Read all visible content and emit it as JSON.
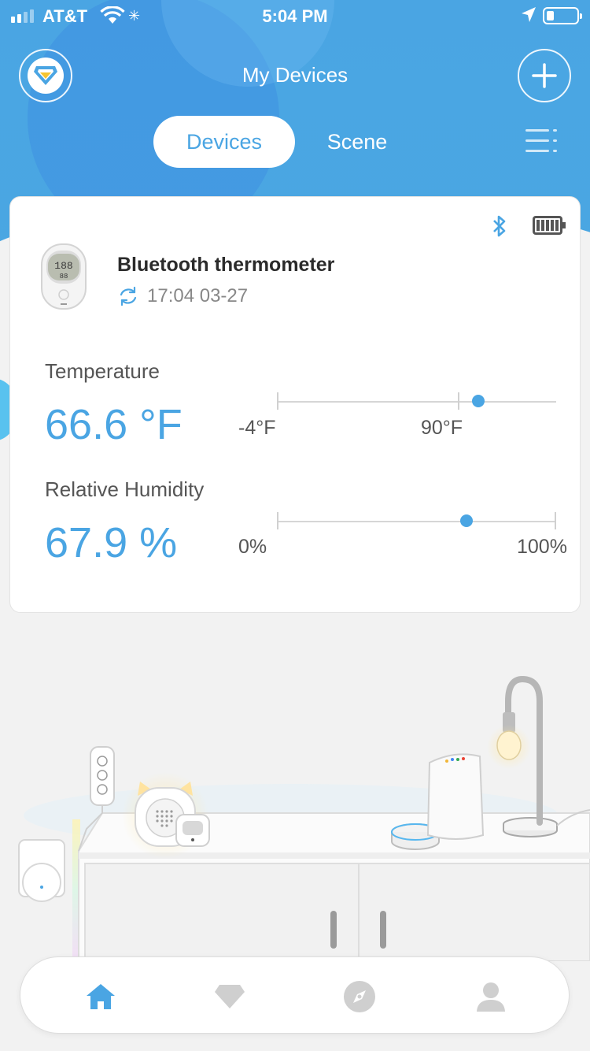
{
  "status_bar": {
    "carrier": "AT&T",
    "time": "5:04 PM"
  },
  "header": {
    "title": "My Devices",
    "tabs": [
      {
        "label": "Devices",
        "active": true
      },
      {
        "label": "Scene",
        "active": false
      }
    ]
  },
  "device": {
    "name": "Bluetooth thermometer",
    "last_sync": "17:04 03-27",
    "icons": [
      "bluetooth-icon",
      "battery-full-icon",
      "sync-icon"
    ]
  },
  "temperature": {
    "label": "Temperature",
    "value": "66.6 °F",
    "range_min_label": "-4°F",
    "range_max_label": "90°F",
    "level_fraction": 0.72
  },
  "humidity": {
    "label": "Relative Humidity",
    "value": "67.9 %",
    "range_min_label": "0%",
    "range_max_label": "100%",
    "level_fraction": 0.679
  },
  "bottom_nav": [
    "home-icon",
    "diamond-icon",
    "compass-icon",
    "profile-icon"
  ],
  "colors": {
    "accent": "#4aa5e3",
    "background": "#f2f2f2"
  }
}
